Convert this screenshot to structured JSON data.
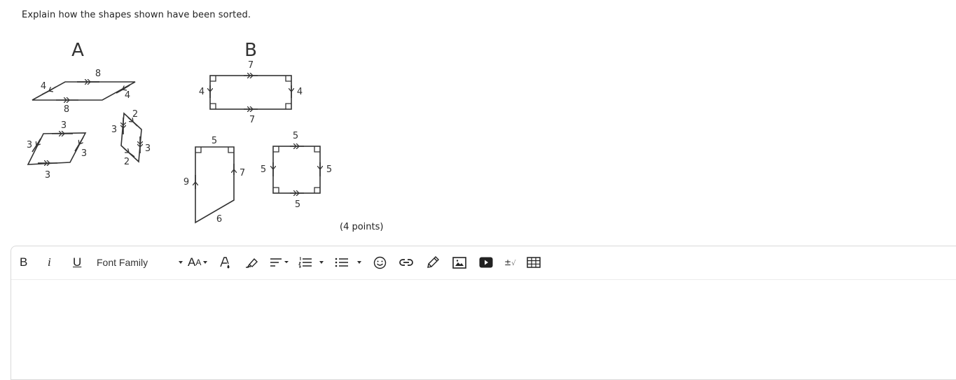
{
  "question": {
    "prompt": "Explain how the shapes shown have been sorted.",
    "points": "(4 points)"
  },
  "figure": {
    "group_a": {
      "label": "A",
      "shapes": [
        {
          "name": "parallelogram-large",
          "sides": [
            "8",
            "4",
            "8",
            "4"
          ],
          "marks": "parallel-arrows"
        },
        {
          "name": "rhombus",
          "sides": [
            "3",
            "3",
            "3",
            "3"
          ],
          "marks": "parallel-arrows"
        },
        {
          "name": "parallelogram-narrow",
          "sides": [
            "2",
            "3",
            "2",
            "3"
          ],
          "marks": "parallel-arrows"
        }
      ],
      "labels": {
        "p1_top": "8",
        "p1_left": "4",
        "p1_right": "4",
        "p1_bottom": "8",
        "p2_top": "3",
        "p2_left": "3",
        "p2_right": "3",
        "p2_bottom": "3",
        "p3_top": "2",
        "p3_left": "3",
        "p3_right": "3",
        "p3_bottom": "2"
      }
    },
    "group_b": {
      "label": "B",
      "shapes": [
        {
          "name": "rectangle",
          "sides": [
            "7",
            "4",
            "7",
            "4"
          ],
          "marks": "right-angles"
        },
        {
          "name": "trapezoid",
          "sides": [
            "5",
            "7",
            "6",
            "9"
          ],
          "marks": "right-angles"
        },
        {
          "name": "square",
          "sides": [
            "5",
            "5",
            "5",
            "5"
          ],
          "marks": "right-angles"
        }
      ],
      "labels": {
        "r_top": "7",
        "r_left": "4",
        "r_right": "4",
        "r_bottom": "7",
        "t_top": "5",
        "t_left": "9",
        "t_right": "7",
        "t_bottom": "6",
        "s_top": "5",
        "s_left": "5",
        "s_right": "5",
        "s_bottom": "5"
      }
    }
  },
  "editor": {
    "toolbar": {
      "bold": "B",
      "italic": "i",
      "underline": "U",
      "font_family": "Font Family",
      "font_size_icon": "AA",
      "buttons": [
        "bold",
        "italic",
        "underline",
        "font-family",
        "font-size",
        "text-color",
        "highlight",
        "align",
        "ordered-list",
        "unordered-list",
        "emoji",
        "link",
        "draw",
        "image",
        "video",
        "math",
        "table"
      ]
    },
    "content": ""
  }
}
